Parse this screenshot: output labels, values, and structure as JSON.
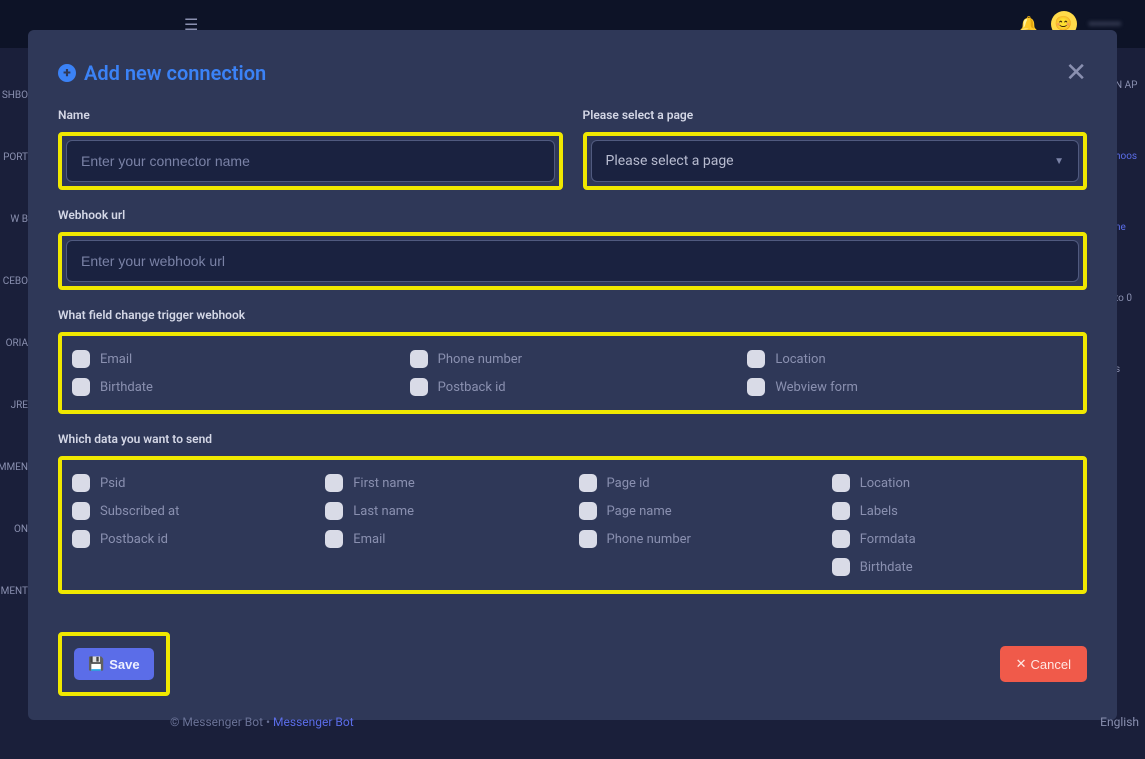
{
  "header": {
    "avatar_face": "😊",
    "username": "••••••••"
  },
  "sidebar": {
    "items": [
      "SHBO",
      "PORT",
      "W B",
      "CEBO",
      "ORIA",
      "JRE",
      "MMEN",
      "ON",
      "MMENT"
    ]
  },
  "right_hints": [
    "N AP",
    "hoos",
    "ne",
    "to 0",
    "s"
  ],
  "modal": {
    "title": "Add new connection",
    "fields": {
      "name_label": "Name",
      "name_placeholder": "Enter your connector name",
      "page_label": "Please select a page",
      "page_select_text": "Please select a page",
      "webhook_label": "Webhook url",
      "webhook_placeholder": "Enter your webhook url"
    },
    "trigger_section": {
      "label": "What field change trigger webhook",
      "items": [
        "Email",
        "Phone number",
        "Location",
        "Birthdate",
        "Postback id",
        "Webview form"
      ]
    },
    "data_section": {
      "label": "Which data you want to send",
      "col1": [
        "Psid",
        "Subscribed at",
        "Postback id"
      ],
      "col2": [
        "First name",
        "Last name",
        "Email"
      ],
      "col3": [
        "Page id",
        "Page name",
        "Phone number"
      ],
      "col4": [
        "Location",
        "Labels",
        "Formdata",
        "Birthdate"
      ]
    },
    "buttons": {
      "save": "Save",
      "cancel": "Cancel"
    }
  },
  "footer": {
    "copyright": "© Messenger Bot",
    "link": "Messenger Bot",
    "language": "English"
  }
}
